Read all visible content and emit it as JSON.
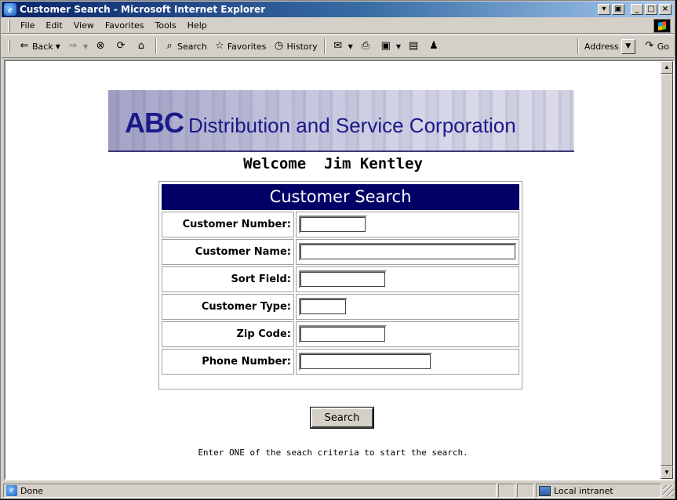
{
  "window": {
    "title": "Customer Search - Microsoft Internet Explorer",
    "controls": {
      "minimize": "_",
      "maximize": "□",
      "close": "×",
      "extra1": "▾",
      "extra2": "▣"
    }
  },
  "menubar": {
    "items": [
      {
        "label": "File"
      },
      {
        "label": "Edit"
      },
      {
        "label": "View"
      },
      {
        "label": "Favorites"
      },
      {
        "label": "Tools"
      },
      {
        "label": "Help"
      }
    ]
  },
  "toolbar": {
    "back": "Back",
    "search": "Search",
    "favorites": "Favorites",
    "history": "History",
    "address_label": "Address",
    "go": "Go"
  },
  "page": {
    "brand_abc": "ABC",
    "brand_rest": "Distribution and Service Corporation",
    "welcome": "Welcome  Jim Kentley",
    "form_title": "Customer Search",
    "fields": [
      {
        "label": "Customer Number:",
        "value": ""
      },
      {
        "label": "Customer Name:",
        "value": ""
      },
      {
        "label": "Sort Field:",
        "value": ""
      },
      {
        "label": "Customer Type:",
        "value": ""
      },
      {
        "label": "Zip Code:",
        "value": ""
      },
      {
        "label": "Phone Number:",
        "value": ""
      }
    ],
    "search_button": "Search",
    "hint": "Enter ONE of the seach criteria to start the search."
  },
  "statusbar": {
    "status": "Done",
    "zone": "Local intranet"
  }
}
